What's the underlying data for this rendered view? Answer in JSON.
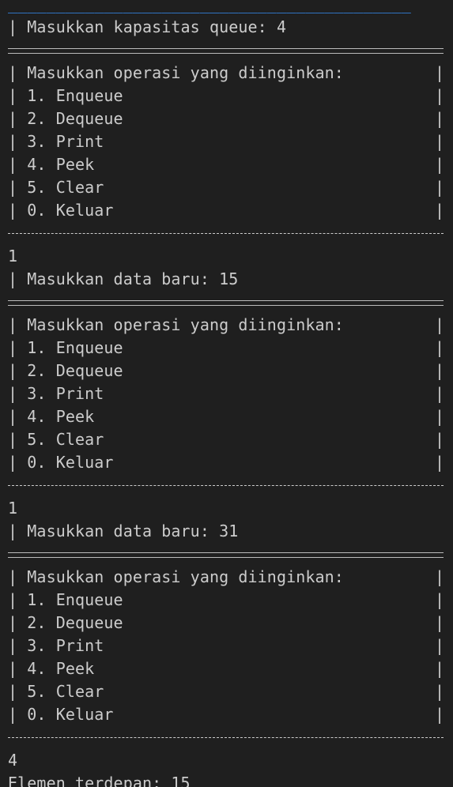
{
  "terminal": {
    "prev_line": "__________________________________________",
    "capacity_prompt": "| Masukkan kapasitas queue: 4",
    "border_char": "|",
    "menu": {
      "title": "| Masukkan operasi yang diinginkan:",
      "items": [
        "| 1. Enqueue",
        "| 2. Dequeue",
        "| 3. Print",
        "| 4. Peek",
        "| 5. Clear",
        "| 0. Keluar"
      ]
    },
    "sessions": [
      {
        "input": "1",
        "response": "| Masukkan data baru: 15"
      },
      {
        "input": "1",
        "response": "| Masukkan data baru: 31"
      },
      {
        "input": "4",
        "response": "Elemen terdepan: 15"
      }
    ]
  }
}
